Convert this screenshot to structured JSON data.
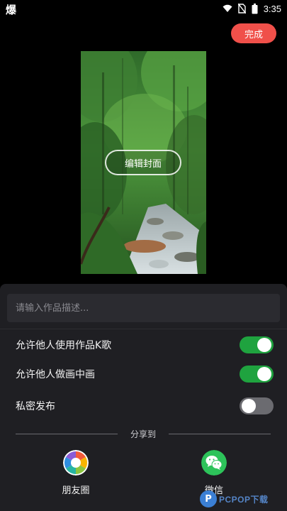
{
  "status_bar": {
    "app_icon": "爆",
    "time": "3:35",
    "icons": [
      "wifi-icon",
      "no-sim-icon",
      "battery-icon"
    ]
  },
  "header": {
    "done_label": "完成"
  },
  "cover": {
    "edit_label": "编辑封面"
  },
  "description": {
    "placeholder": "请输入作品描述...",
    "value": ""
  },
  "settings": [
    {
      "label": "允许他人使用作品K歌",
      "enabled": true
    },
    {
      "label": "允许他人做画中画",
      "enabled": true
    },
    {
      "label": "私密发布",
      "enabled": false
    }
  ],
  "share": {
    "title": "分享到",
    "targets": [
      {
        "label": "朋友圈",
        "icon": "moments-icon"
      },
      {
        "label": "微信",
        "icon": "wechat-icon"
      }
    ]
  },
  "watermark": {
    "text": "PCPOP下载",
    "badge": "P"
  },
  "colors": {
    "accent": "#f0504a",
    "toggle_on": "#1fa33f",
    "toggle_off": "#6b6b70",
    "sheet_bg": "#1f1f23",
    "wechat_green": "#2dc35a"
  }
}
